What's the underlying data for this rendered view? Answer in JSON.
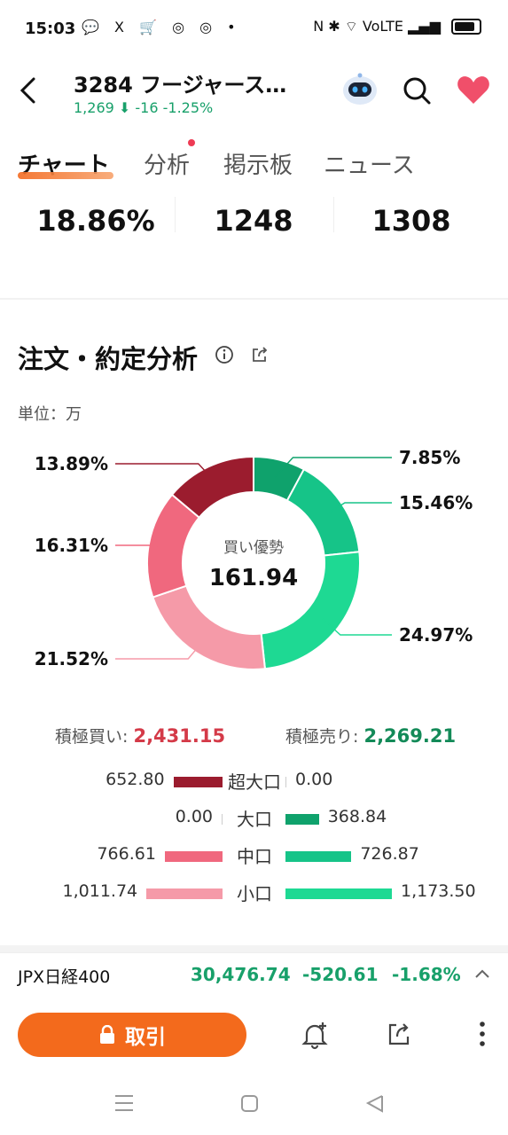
{
  "status_bar": {
    "time": "15:03",
    "apps": "💬 X 🛒 ◎ ◎ •",
    "right": "N ✱ ⌔ VoLTE ▂▄▆"
  },
  "header": {
    "title": "3284 フージャース…",
    "price": "1,269",
    "change": "-16",
    "change_pct": "-1.25%"
  },
  "tabs": [
    {
      "label": "チャート"
    },
    {
      "label": "分析"
    },
    {
      "label": "掲示板"
    },
    {
      "label": "ニュース"
    }
  ],
  "stats": [
    "18.86%",
    "1248",
    "1308"
  ],
  "section": {
    "title": "注文・約定分析",
    "unit": "単位：万"
  },
  "donut": {
    "center_label": "買い優勢",
    "center_value": "161.94",
    "colors": {
      "sell_super": "#9b1c2e",
      "sell_mid": "#f0687e",
      "sell_small": "#f59aa8",
      "buy_large": "#0fa26c",
      "buy_mid": "#16c488",
      "buy_small": "#1ed993"
    }
  },
  "chart_data": {
    "type": "pie",
    "slices": [
      {
        "label": "7.85%",
        "value": 7.85,
        "color": "#0fa26c"
      },
      {
        "label": "15.46%",
        "value": 15.46,
        "color": "#16c488"
      },
      {
        "label": "24.97%",
        "value": 24.97,
        "color": "#1ed993"
      },
      {
        "label": "21.52%",
        "value": 21.52,
        "color": "#f59aa8"
      },
      {
        "label": "16.31%",
        "value": 16.31,
        "color": "#f0687e"
      },
      {
        "label": "13.89%",
        "value": 13.89,
        "color": "#9b1c2e"
      }
    ]
  },
  "totals": {
    "buy_label": "積極買い:",
    "buy_value": "2,431.15",
    "sell_label": "積極売り:",
    "sell_value": "2,269.21"
  },
  "rows": [
    {
      "label": "超大口",
      "left": "652.80",
      "left_val": 652.8,
      "right": "0.00",
      "right_val": 0
    },
    {
      "label": "大口",
      "left": "0.00",
      "left_val": 0,
      "right": "368.84",
      "right_val": 368.84
    },
    {
      "label": "中口",
      "left": "766.61",
      "left_val": 766.61,
      "right": "726.87",
      "right_val": 726.87
    },
    {
      "label": "小口",
      "left": "1,011.74",
      "left_val": 1011.74,
      "right": "1,173.50",
      "right_val": 1173.5
    }
  ],
  "index": {
    "name": "JPX日経400",
    "value": "30,476.74",
    "change": "-520.61",
    "pct": "-1.68%"
  },
  "trade_button": "取引"
}
